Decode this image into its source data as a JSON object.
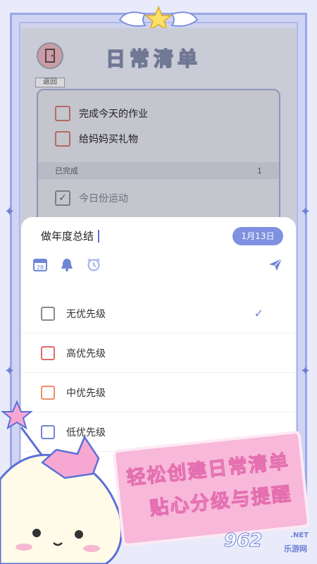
{
  "header": {
    "back_label": "返回",
    "title": "日常清单"
  },
  "todos": [
    {
      "text": "完成今天的作业"
    },
    {
      "text": "给妈妈买礼物"
    }
  ],
  "done_section": {
    "label": "已完成",
    "count": "1",
    "items": [
      {
        "text": "今日份运动"
      }
    ]
  },
  "sheet": {
    "input_value": "做年度总结",
    "date_label": "1月13日",
    "calendar_day": "28",
    "priorities": [
      {
        "label": "无优先级",
        "color": "#8a8a8a",
        "selected": true
      },
      {
        "label": "高优先级",
        "color": "#e06a6a",
        "selected": false
      },
      {
        "label": "中优先级",
        "color": "#e8906a",
        "selected": false
      },
      {
        "label": "低优先级",
        "color": "#6f86d6",
        "selected": false
      }
    ]
  },
  "banner": {
    "line1": "轻松创建日常清单",
    "line2": "贴心分级与提醒"
  },
  "watermark": {
    "number": "962",
    "suffix": ".NET",
    "site": "乐游网"
  },
  "colors": {
    "accent": "#7f91e0",
    "frame": "#9aa8e6",
    "banner": "#f7b8da"
  }
}
